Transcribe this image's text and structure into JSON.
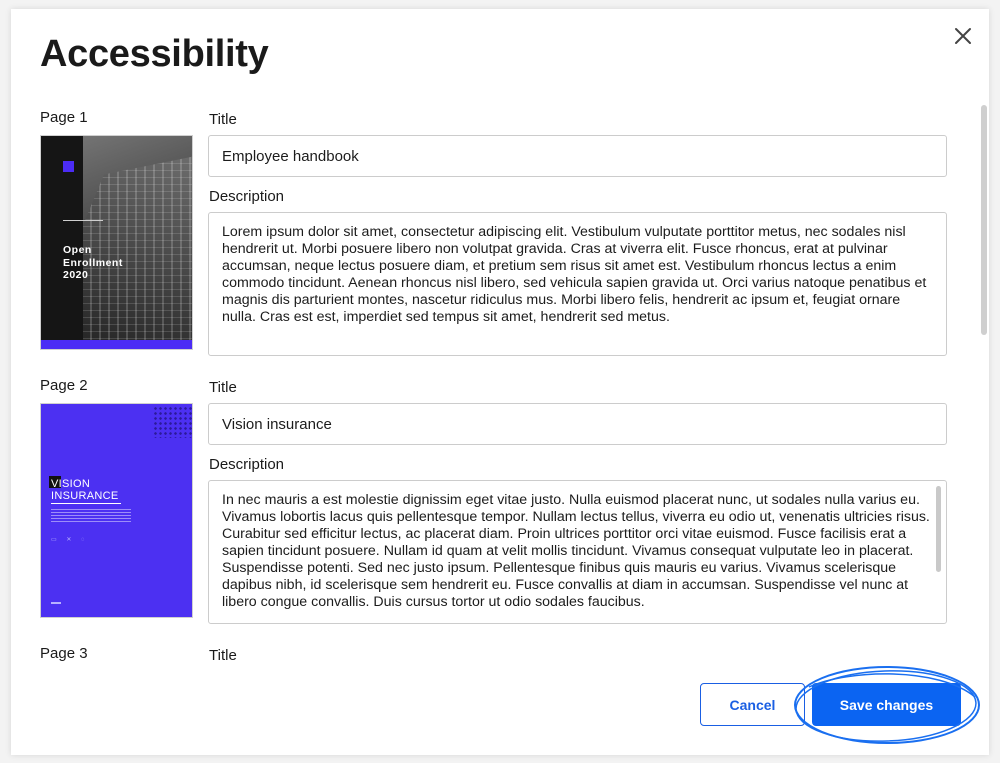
{
  "modal": {
    "title": "Accessibility"
  },
  "pages": [
    {
      "label": "Page 1",
      "title_label": "Title",
      "title_value": "Employee handbook",
      "description_label": "Description",
      "description_value": "Lorem ipsum dolor sit amet, consectetur adipiscing elit. Vestibulum vulputate porttitor metus, nec sodales nisl hendrerit ut. Morbi posuere libero non volutpat gravida. Cras at viverra elit. Fusce rhoncus, erat at pulvinar accumsan, neque lectus posuere diam, et pretium sem risus sit amet est. Vestibulum rhoncus lectus a enim commodo tincidunt. Aenean rhoncus nisl libero, sed vehicula sapien gravida ut. Orci varius natoque penatibus et magnis dis parturient montes, nascetur ridiculus mus. Morbi libero felis, hendrerit ac ipsum et, feugiat ornare nulla. Cras est est, imperdiet sed tempus sit amet, hendrerit sed metus.",
      "thumbnail": {
        "heading": "Open Enrollment 2020"
      }
    },
    {
      "label": "Page 2",
      "title_label": "Title",
      "title_value": "Vision insurance",
      "description_label": "Description",
      "description_value": "In nec mauris a est molestie dignissim eget vitae justo. Nulla euismod placerat nunc, ut sodales nulla varius eu. Vivamus lobortis lacus quis pellentesque tempor. Nullam lectus tellus, viverra eu odio ut, venenatis ultricies risus. Curabitur sed efficitur lectus, ac placerat diam. Proin ultrices porttitor orci vitae euismod. Fusce facilisis erat a sapien tincidunt posuere. Nullam id quam at velit mollis tincidunt. Vivamus consequat vulputate leo in placerat. Suspendisse potenti. Sed nec justo ipsum. Pellentesque finibus quis mauris eu varius. Vivamus scelerisque dapibus nibh, id scelerisque sem hendrerit eu. Fusce convallis at diam in accumsan. Suspendisse vel nunc at libero congue convallis. Duis cursus tortor ut odio sodales faucibus.",
      "thumbnail": {
        "heading": "VISION INSURANCE"
      }
    },
    {
      "label": "Page 3",
      "title_label": "Title"
    }
  ],
  "footer": {
    "cancel_label": "Cancel",
    "save_label": "Save changes"
  },
  "colors": {
    "accent": "#0b64f2",
    "brand_purple": "#4c30f2"
  }
}
